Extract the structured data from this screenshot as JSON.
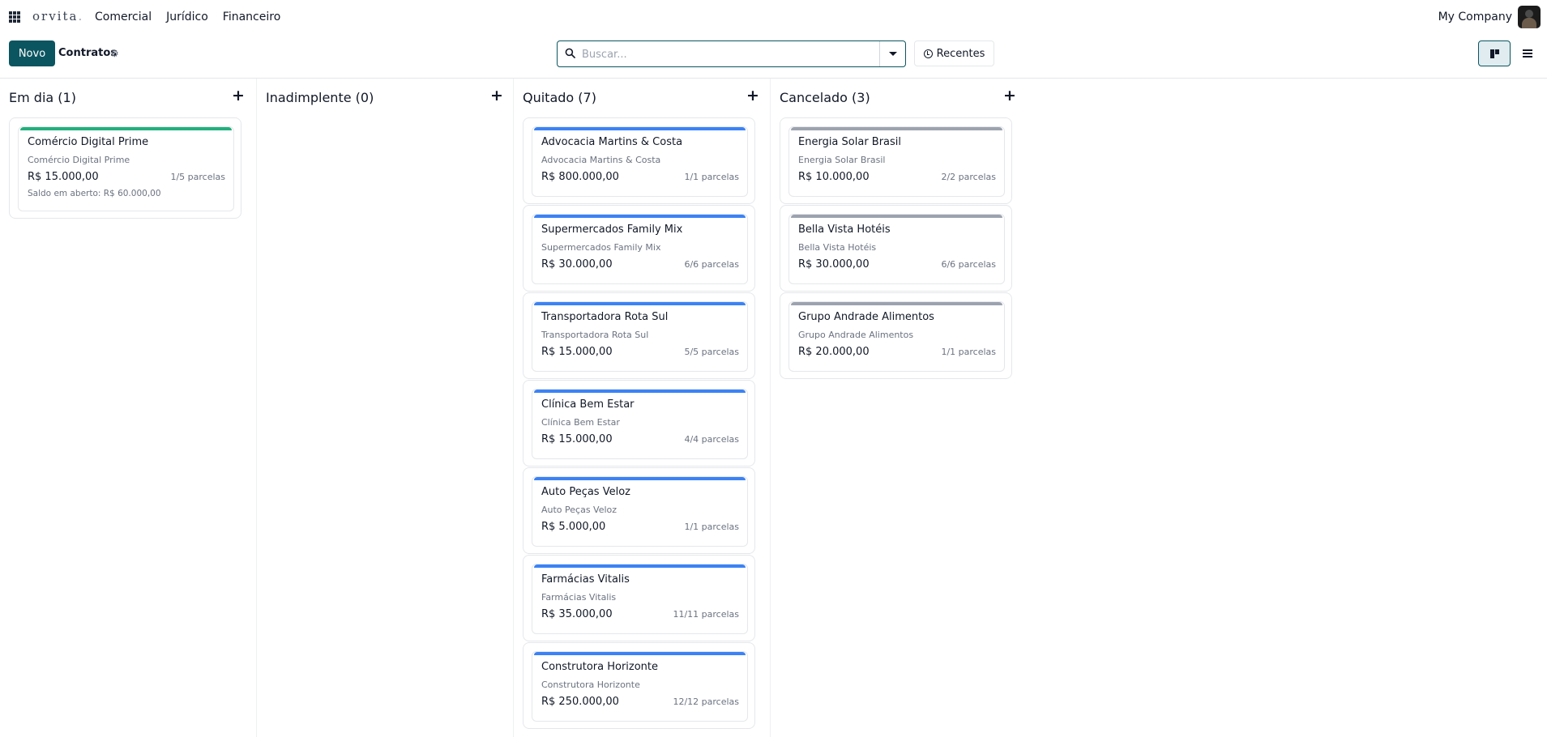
{
  "navbar": {
    "brand": "orvita",
    "brand_dot": ".",
    "menu": [
      "Comercial",
      "Jurídico",
      "Financeiro"
    ],
    "company": "My Company"
  },
  "control_panel": {
    "new_label": "Novo",
    "breadcrumb": "Contratos",
    "search_placeholder": "Buscar...",
    "recent_label": "Recentes",
    "active_view": "kanban"
  },
  "colors": {
    "primary": "#0b5560",
    "em_dia": "#22b07d",
    "quitado": "#3b82f6",
    "cancelado": "#9ca3af"
  },
  "columns": [
    {
      "title": "Em dia (1)",
      "bar_color": "#22b07d",
      "cards": [
        {
          "title": "Comércio Digital Prime",
          "subtitle": "Comércio Digital Prime",
          "amount": "R$ 15.000,00",
          "installments": "1/5 parcelas",
          "balance": "Saldo em aberto: R$ 60.000,00"
        }
      ]
    },
    {
      "title": "Inadimplente (0)",
      "bar_color": "#ef4444",
      "cards": []
    },
    {
      "title": "Quitado (7)",
      "bar_color": "#3b82f6",
      "cards": [
        {
          "title": "Advocacia Martins & Costa",
          "subtitle": "Advocacia Martins & Costa",
          "amount": "R$ 800.000,00",
          "installments": "1/1 parcelas"
        },
        {
          "title": "Supermercados Family Mix",
          "subtitle": "Supermercados Family Mix",
          "amount": "R$ 30.000,00",
          "installments": "6/6 parcelas"
        },
        {
          "title": "Transportadora Rota Sul",
          "subtitle": "Transportadora Rota Sul",
          "amount": "R$ 15.000,00",
          "installments": "5/5 parcelas"
        },
        {
          "title": "Clínica Bem Estar",
          "subtitle": "Clínica Bem Estar",
          "amount": "R$ 15.000,00",
          "installments": "4/4 parcelas"
        },
        {
          "title": "Auto Peças Veloz",
          "subtitle": "Auto Peças Veloz",
          "amount": "R$ 5.000,00",
          "installments": "1/1 parcelas"
        },
        {
          "title": "Farmácias Vitalis",
          "subtitle": "Farmácias Vitalis",
          "amount": "R$ 35.000,00",
          "installments": "11/11 parcelas"
        },
        {
          "title": "Construtora Horizonte",
          "subtitle": "Construtora Horizonte",
          "amount": "R$ 250.000,00",
          "installments": "12/12 parcelas"
        }
      ]
    },
    {
      "title": "Cancelado (3)",
      "bar_color": "#9ca3af",
      "cards": [
        {
          "title": "Energia Solar Brasil",
          "subtitle": "Energia Solar Brasil",
          "amount": "R$ 10.000,00",
          "installments": "2/2 parcelas"
        },
        {
          "title": "Bella Vista Hotéis",
          "subtitle": "Bella Vista Hotéis",
          "amount": "R$ 30.000,00",
          "installments": "6/6 parcelas"
        },
        {
          "title": "Grupo Andrade Alimentos",
          "subtitle": "Grupo Andrade Alimentos",
          "amount": "R$ 20.000,00",
          "installments": "1/1 parcelas"
        }
      ]
    }
  ]
}
